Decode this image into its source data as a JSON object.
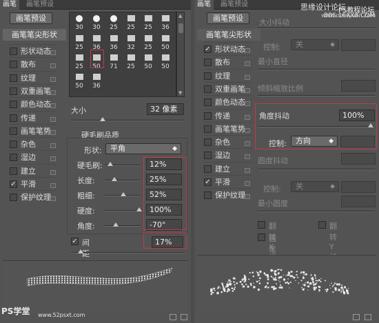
{
  "left": {
    "tabs": [
      "画笔",
      "画笔预设"
    ],
    "preset_button": "画笔预设",
    "tip_shape": "画笔笔尖形状",
    "options": [
      {
        "label": "形状动态",
        "checked": false
      },
      {
        "label": "散布",
        "checked": false
      },
      {
        "label": "纹理",
        "checked": false
      },
      {
        "label": "双重画笔",
        "checked": false
      },
      {
        "label": "颜色动态",
        "checked": false
      },
      {
        "label": "传递",
        "checked": false
      },
      {
        "label": "画笔笔势",
        "checked": false
      },
      {
        "label": "杂色",
        "checked": false
      },
      {
        "label": "湿边",
        "checked": false
      },
      {
        "label": "建立",
        "checked": false
      },
      {
        "label": "平滑",
        "checked": true
      },
      {
        "label": "保护纹理",
        "checked": false
      }
    ],
    "grid_numbers": [
      "30",
      "30",
      "25",
      "25",
      "25",
      "36",
      "25",
      "36",
      "36",
      "32",
      "25",
      "50",
      "25",
      "50",
      "71",
      "25",
      "50",
      "50",
      "50",
      "36"
    ],
    "size_label": "大小",
    "size_value": "32 像素",
    "bristle_title": "硬毛刷品质",
    "shape_label": "形状:",
    "shape_value": "平角",
    "params": [
      {
        "label": "硬毛刷:",
        "value": "12%",
        "level": 0.12
      },
      {
        "label": "长度:",
        "value": "25%",
        "level": 0.25
      },
      {
        "label": "粗细:",
        "value": "52%",
        "level": 0.52
      },
      {
        "label": "硬度:",
        "value": "100%",
        "level": 1.0
      },
      {
        "label": "角度:",
        "value": "-70°",
        "level": 0.3
      }
    ],
    "spacing_label": "间距",
    "spacing_checked": true,
    "spacing_value": "17%"
  },
  "right": {
    "tabs": [
      "画笔",
      "画笔预设"
    ],
    "watermark_top": "思缘设计论坛",
    "watermark_url": "www.missyuan.com",
    "watermark_ps": "PS教程论坛",
    "watermark_bbs": "BBS.16XX8.COM",
    "preset_button": "画笔预设",
    "tip_shape": "画笔笔尖形状",
    "top_cut_label": "大小抖动",
    "options": [
      {
        "label": "形状动态",
        "checked": true
      },
      {
        "label": "散布",
        "checked": false
      },
      {
        "label": "纹理",
        "checked": false
      },
      {
        "label": "双重画笔",
        "checked": false
      },
      {
        "label": "颜色动态",
        "checked": false
      },
      {
        "label": "传递",
        "checked": false
      },
      {
        "label": "画笔笔势",
        "checked": false
      },
      {
        "label": "杂色",
        "checked": false
      },
      {
        "label": "湿边",
        "checked": false
      },
      {
        "label": "建立",
        "checked": false
      },
      {
        "label": "平滑",
        "checked": true
      },
      {
        "label": "保护纹理",
        "checked": false
      }
    ],
    "control1_label": "控制:",
    "control1_value": "关",
    "min_diameter": "最小直径",
    "tilt_scale": "倾斜缩放比例",
    "angle_jitter": "角度抖动",
    "angle_value": "100%",
    "control2_label": "控制:",
    "control2_value": "方向",
    "round_jitter": "圆度抖动",
    "control3_label": "控制:",
    "control3_value": "关",
    "min_round": "最小圆度",
    "flip_x": "翻转 X 抖动",
    "flip_y": "翻转 Y 抖动",
    "brush_projection": "画笔投影"
  },
  "watermark_bl": "PS学堂",
  "watermark_bl2": "www.52psxt.com"
}
